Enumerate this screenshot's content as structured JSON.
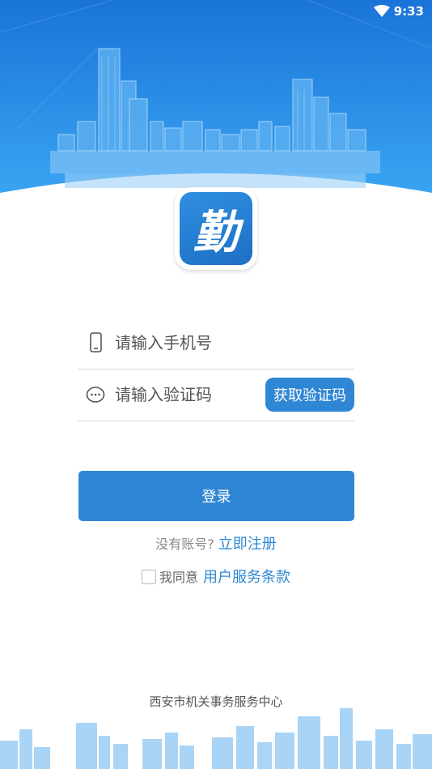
{
  "status_bar": {
    "time": "9:33",
    "wifi_icon": "wifi-icon"
  },
  "logo": {
    "char": "勤"
  },
  "phone_field": {
    "placeholder": "请输入手机号",
    "icon": "phone-icon"
  },
  "code_field": {
    "placeholder": "请输入验证码",
    "icon": "message-icon",
    "button_label": "获取验证码"
  },
  "login_button": {
    "label": "登录"
  },
  "register": {
    "prompt": "没有账号?",
    "link": "立即注册"
  },
  "agreement": {
    "checked": false,
    "prefix": "我同意",
    "link": "用户服务条款"
  },
  "footer": {
    "org": "西安市机关事务服务中心"
  },
  "colors": {
    "primary": "#2f86d4",
    "hero_top": "#1a78dc",
    "hero_bottom": "#3aa0f0"
  }
}
